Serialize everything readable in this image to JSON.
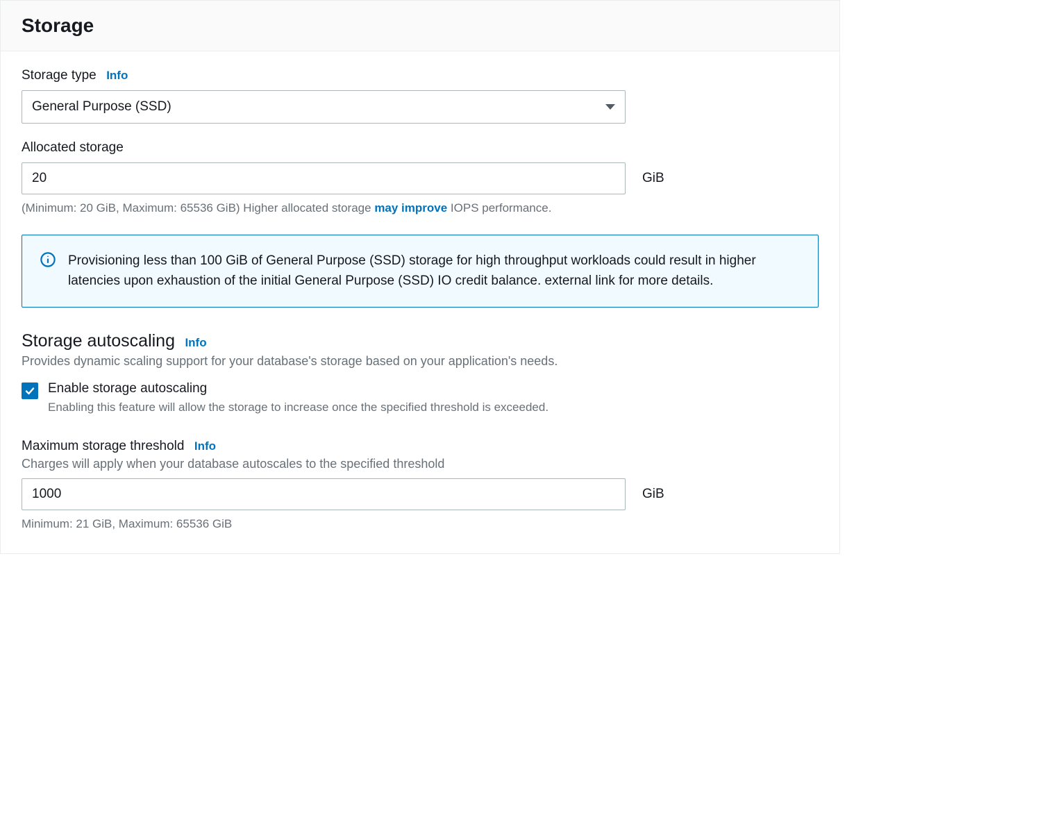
{
  "header": {
    "title": "Storage"
  },
  "storageType": {
    "label": "Storage type",
    "infoLabel": "Info",
    "selected": "General Purpose (SSD)"
  },
  "allocatedStorage": {
    "label": "Allocated storage",
    "value": "20",
    "unit": "GiB",
    "helperPrefix": "(Minimum: 20 GiB, Maximum: 65536 GiB) Higher allocated storage ",
    "helperLink": "may improve",
    "helperSuffix": " IOPS performance."
  },
  "alert": {
    "text": "Provisioning less than 100 GiB of General Purpose (SSD) storage for high throughput workloads could result in higher latencies upon exhaustion of the initial General Purpose (SSD) IO credit balance. external link for more details."
  },
  "autoscaling": {
    "title": "Storage autoscaling",
    "infoLabel": "Info",
    "description": "Provides dynamic scaling support for your database's storage based on your application's needs.",
    "checkboxLabel": "Enable storage autoscaling",
    "checkboxDesc": "Enabling this feature will allow the storage to increase once the specified threshold is exceeded.",
    "checked": true
  },
  "threshold": {
    "label": "Maximum storage threshold",
    "infoLabel": "Info",
    "description": "Charges will apply when your database autoscales to the specified threshold",
    "value": "1000",
    "unit": "GiB",
    "helper": "Minimum: 21 GiB, Maximum: 65536 GiB"
  }
}
